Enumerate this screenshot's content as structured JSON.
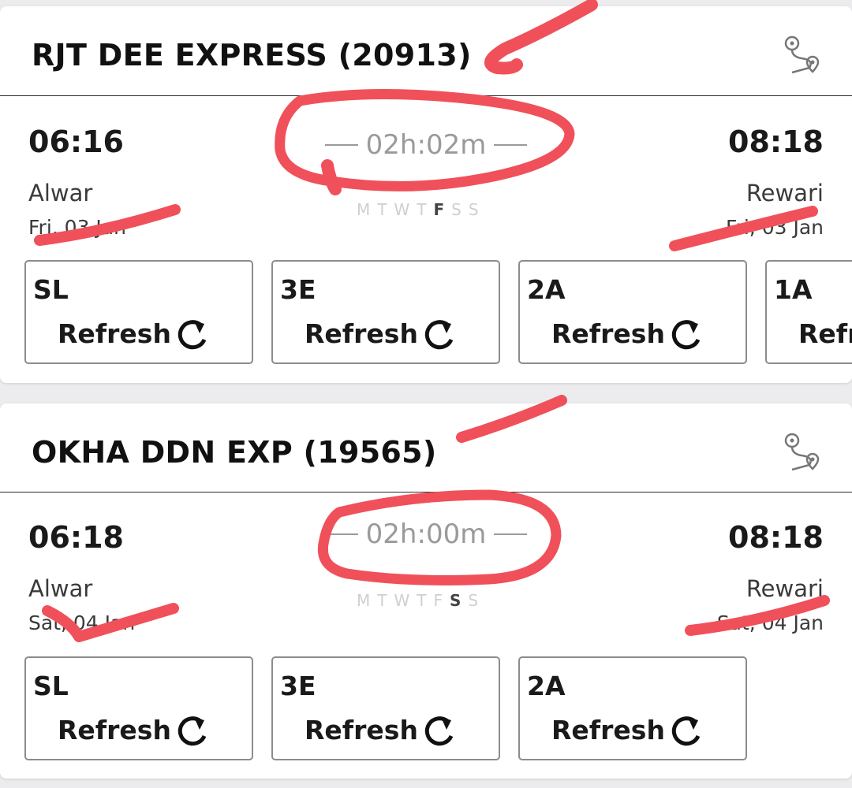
{
  "trains": [
    {
      "name": "RJT DEE EXPRESS (20913)",
      "dep_time": "06:16",
      "arr_time": "08:18",
      "duration": "02h:02m",
      "from_station": "Alwar",
      "to_station": "Rewari",
      "from_date": "Fri, 03 Jan",
      "to_date": "Fri, 03 Jan",
      "days": [
        "M",
        "T",
        "W",
        "T",
        "F",
        "S",
        "S"
      ],
      "active_day": "F",
      "classes": [
        {
          "code": "SL",
          "action": "Refresh"
        },
        {
          "code": "3E",
          "action": "Refresh"
        },
        {
          "code": "2A",
          "action": "Refresh"
        },
        {
          "code": "1A",
          "action": "Refr"
        }
      ]
    },
    {
      "name": "OKHA DDN EXP (19565)",
      "dep_time": "06:18",
      "arr_time": "08:18",
      "duration": "02h:00m",
      "from_station": "Alwar",
      "to_station": "Rewari",
      "from_date": "Sat, 04 Jan",
      "to_date": "Sat, 04 Jan",
      "days": [
        "M",
        "T",
        "W",
        "T",
        "F",
        "S",
        "S"
      ],
      "active_day": "S",
      "classes": [
        {
          "code": "SL",
          "action": "Refresh"
        },
        {
          "code": "3E",
          "action": "Refresh"
        },
        {
          "code": "2A",
          "action": "Refresh"
        }
      ]
    }
  ],
  "icons": {
    "route": "route-map-icon",
    "refresh": "refresh-icon"
  },
  "colors": {
    "annotation": "#f0505a",
    "border": "#8c8c8c",
    "muted": "#9a9a9a"
  }
}
